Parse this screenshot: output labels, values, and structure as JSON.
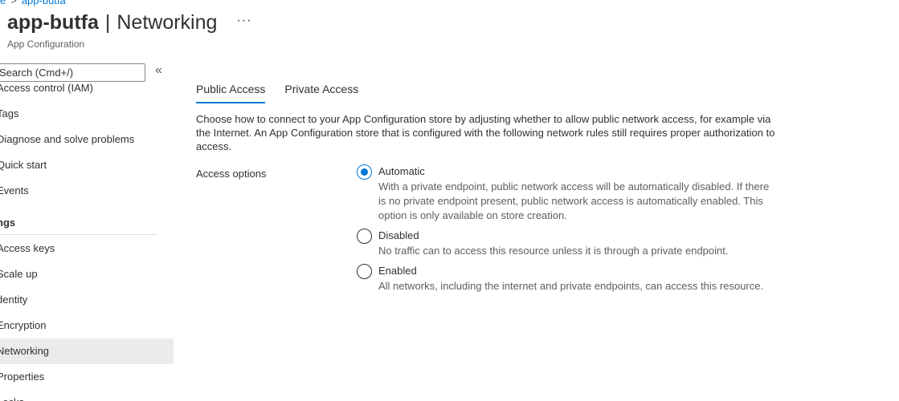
{
  "breadcrumb": {
    "parent_label": "e",
    "separator": ">",
    "current_label": "app-butfa"
  },
  "header": {
    "resource_name": "app-butfa",
    "separator": "|",
    "section_name": "Networking",
    "more_label": "···",
    "subtitle": "App Configuration"
  },
  "sidebar": {
    "search_placeholder": "Search (Cmd+/)",
    "collapse_label": "«",
    "items": [
      {
        "label": "Access control (IAM)"
      },
      {
        "label": "Tags"
      },
      {
        "label": "Diagnose and solve problems"
      },
      {
        "label": "Quick start"
      },
      {
        "label": "Events"
      }
    ],
    "group_label": "ngs",
    "settings_items": [
      {
        "label": "Access keys"
      },
      {
        "label": "Scale up"
      },
      {
        "label": "dentity"
      },
      {
        "label": "Encryption"
      },
      {
        "label": "Networking",
        "selected": true
      },
      {
        "label": "Properties"
      },
      {
        "label": "Locks"
      }
    ]
  },
  "main": {
    "tabs": [
      {
        "label": "Public Access",
        "active": true
      },
      {
        "label": "Private Access",
        "active": false
      }
    ],
    "description": "Choose how to connect to your App Configuration store by adjusting whether to allow public network access, for example via the Internet. An App Configuration store that is configured with the following network rules still requires proper authorization to access.",
    "access_options_label": "Access options",
    "options": [
      {
        "label": "Automatic",
        "checked": true,
        "description": "With a private endpoint, public network access will be automatically disabled. If there is no private endpoint present, public network access is automatically enabled. This option is only available on store creation."
      },
      {
        "label": "Disabled",
        "checked": false,
        "description": "No traffic can to access this resource unless it is through a private endpoint."
      },
      {
        "label": "Enabled",
        "checked": false,
        "description": "All networks, including the internet and private endpoints, can access this resource."
      }
    ]
  },
  "colors": {
    "accent": "#0078d4",
    "selected_bg": "#edebe9",
    "text": "#323130",
    "secondary_text": "#605e5c"
  }
}
